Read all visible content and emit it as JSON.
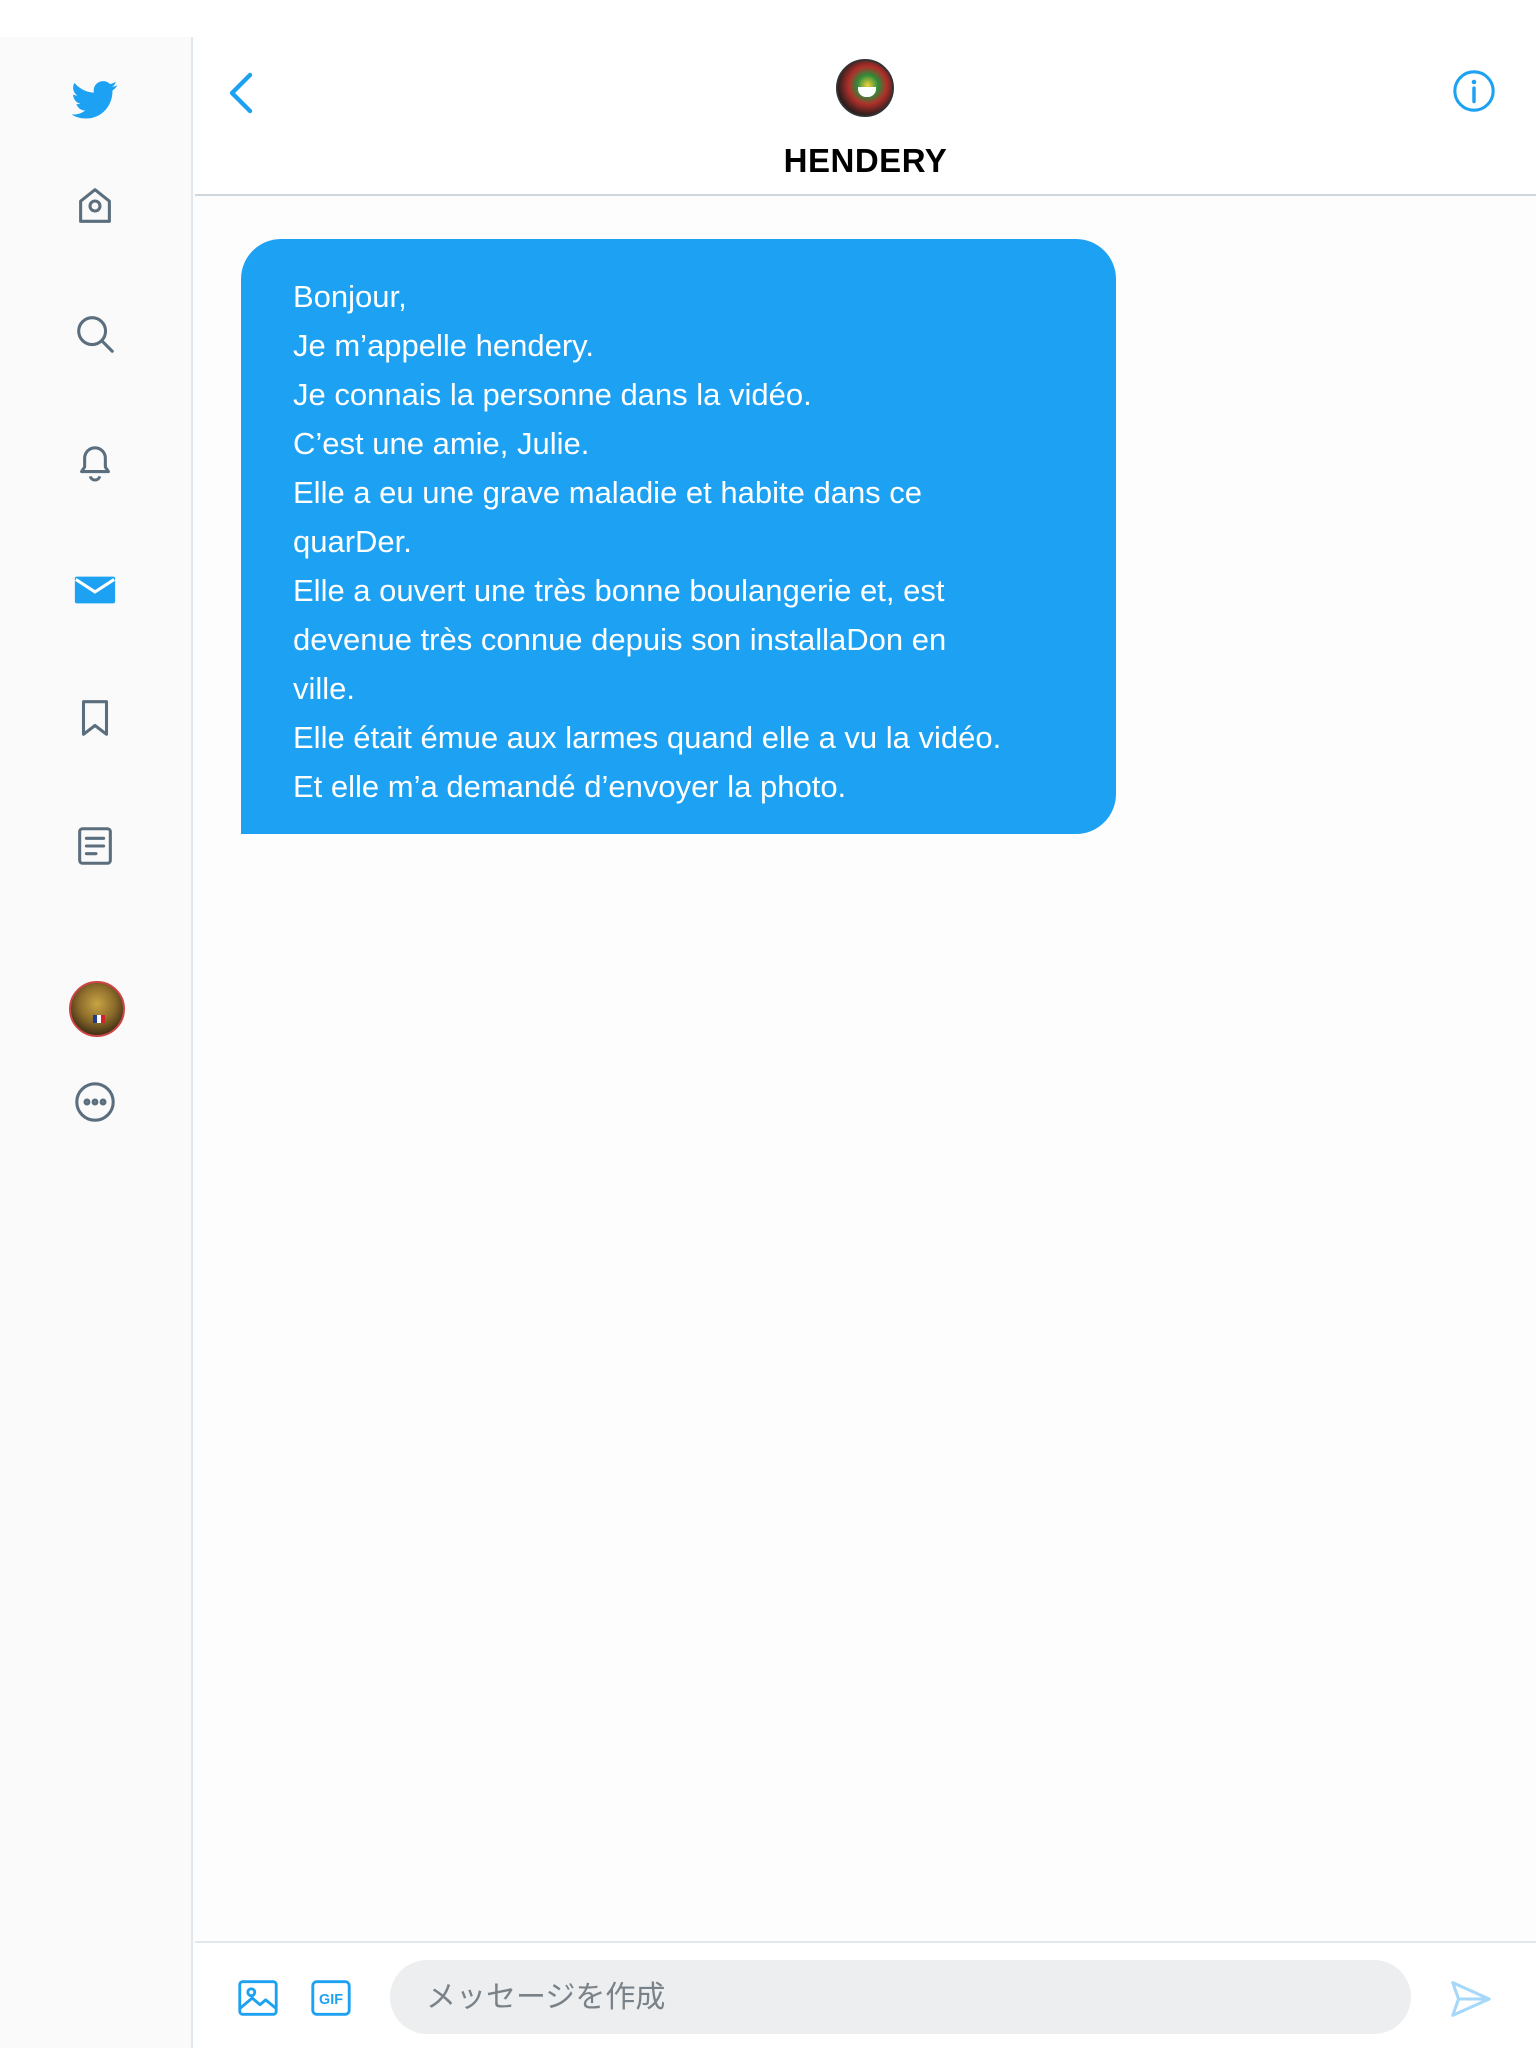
{
  "colors": {
    "accent": "#1da1f2",
    "icon_gray": "#5b6e7e",
    "bubble_text": "#ffffff"
  },
  "sidebar": {
    "items": [
      {
        "icon": "twitter-bird-icon"
      },
      {
        "icon": "home-icon"
      },
      {
        "icon": "search-icon"
      },
      {
        "icon": "notifications-bell-icon"
      },
      {
        "icon": "messages-envelope-icon",
        "active": true
      },
      {
        "icon": "bookmark-icon"
      },
      {
        "icon": "lists-icon"
      },
      {
        "icon": "profile-avatar"
      },
      {
        "icon": "more-icon"
      }
    ]
  },
  "conversation": {
    "name": "HENDERY"
  },
  "message": {
    "lines": [
      "Bonjour,",
      "Je m’appelle hendery.",
      "Je connais la personne dans la vidéo.",
      "C’est une amie, Julie.",
      "Elle a eu une grave maladie et habite dans ce",
      "quarDer.",
      "Elle a ouvert une très bonne boulangerie et, est",
      "devenue très connue depuis son installaDon en",
      "ville.",
      "Elle était émue aux larmes quand elle a vu la vidéo.",
      "Et elle m’a demandé d’envoyer la photo."
    ]
  },
  "composer": {
    "placeholder": "メッセージを作成",
    "gif_label": "GIF"
  }
}
